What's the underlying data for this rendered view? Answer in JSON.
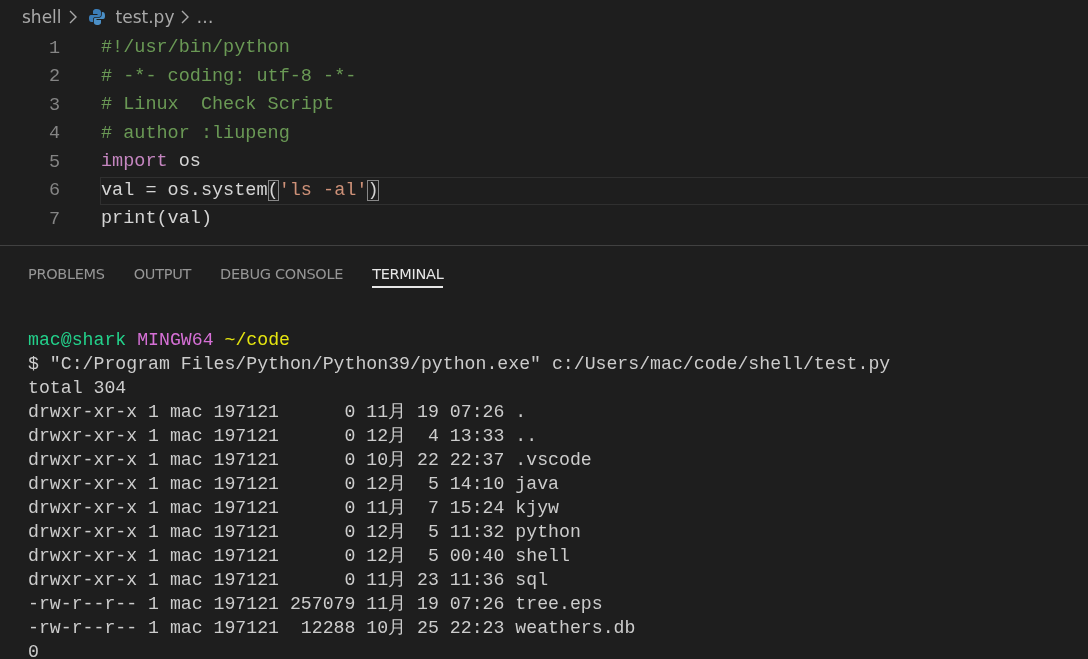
{
  "breadcrumb": [
    {
      "label": "shell",
      "kind": "folder"
    },
    {
      "label": "test.py",
      "kind": "python-file"
    },
    {
      "label": "…",
      "kind": "more"
    }
  ],
  "editor": {
    "lines": [
      {
        "number": "1",
        "current": false,
        "tokens": [
          {
            "text": "#!/usr/bin/python",
            "kind": "comment"
          }
        ]
      },
      {
        "number": "2",
        "current": false,
        "tokens": [
          {
            "text": "# -*- coding: utf-8 -*-",
            "kind": "comment"
          }
        ]
      },
      {
        "number": "3",
        "current": false,
        "tokens": [
          {
            "text": "# Linux  Check Script",
            "kind": "comment"
          }
        ]
      },
      {
        "number": "4",
        "current": false,
        "tokens": [
          {
            "text": "# author :liupeng",
            "kind": "comment"
          }
        ]
      },
      {
        "number": "5",
        "current": false,
        "tokens": [
          {
            "text": "import",
            "kind": "keyword"
          },
          {
            "text": " os",
            "kind": "plain"
          }
        ]
      },
      {
        "number": "6",
        "current": true,
        "tokens": [
          {
            "text": "val = os.system",
            "kind": "plain"
          },
          {
            "text": "(",
            "kind": "matched-bracket"
          },
          {
            "text": "'ls -al'",
            "kind": "string"
          },
          {
            "text": ")",
            "kind": "matched-bracket"
          }
        ]
      },
      {
        "number": "7",
        "current": false,
        "tokens": [
          {
            "text": "print(val)",
            "kind": "plain"
          }
        ]
      }
    ]
  },
  "panel_tabs": [
    {
      "label": "PROBLEMS",
      "selected": false
    },
    {
      "label": "OUTPUT",
      "selected": false
    },
    {
      "label": "DEBUG CONSOLE",
      "selected": false
    },
    {
      "label": "TERMINAL",
      "selected": true
    }
  ],
  "terminal": {
    "prompt": {
      "user_host": "mac@shark",
      "system": "MINGW64",
      "path": "~/code"
    },
    "lines": [
      "$ \"C:/Program Files/Python/Python39/python.exe\" c:/Users/mac/code/shell/test.py",
      "total 304",
      "drwxr-xr-x 1 mac 197121      0 11月 19 07:26 .",
      "drwxr-xr-x 1 mac 197121      0 12月  4 13:33 ..",
      "drwxr-xr-x 1 mac 197121      0 10月 22 22:37 .vscode",
      "drwxr-xr-x 1 mac 197121      0 12月  5 14:10 java",
      "drwxr-xr-x 1 mac 197121      0 11月  7 15:24 kjyw",
      "drwxr-xr-x 1 mac 197121      0 12月  5 11:32 python",
      "drwxr-xr-x 1 mac 197121      0 12月  5 00:40 shell",
      "drwxr-xr-x 1 mac 197121      0 11月 23 11:36 sql",
      "-rw-r--r-- 1 mac 197121 257079 11月 19 07:26 tree.eps",
      "-rw-r--r-- 1 mac 197121  12288 10月 25 22:23 weathers.db",
      "0"
    ]
  }
}
